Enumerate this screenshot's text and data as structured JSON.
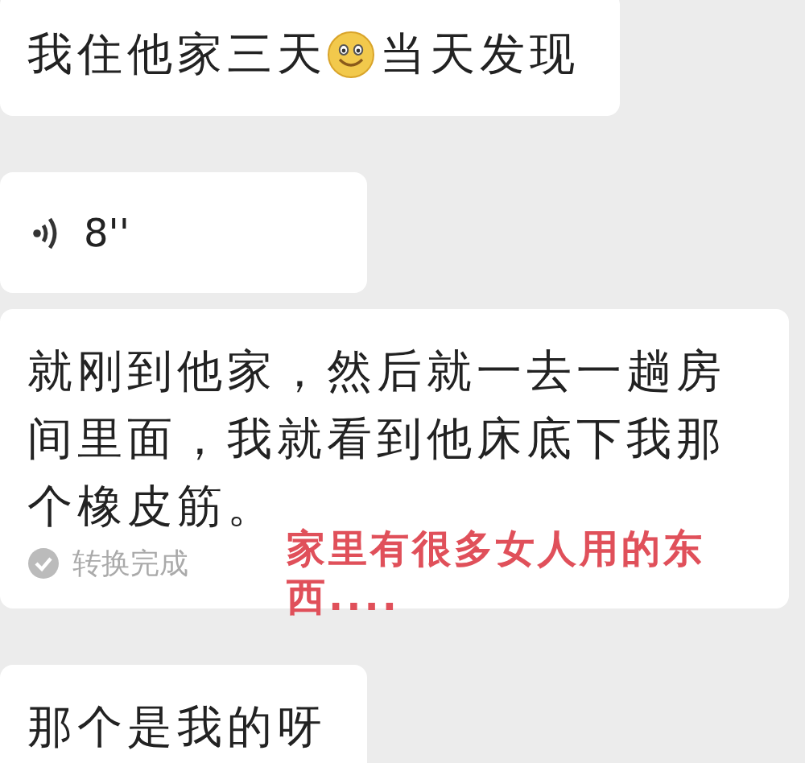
{
  "messages": [
    {
      "kind": "text",
      "segments": [
        {
          "kind": "text",
          "text": "我住他家三天"
        },
        {
          "kind": "emoji"
        },
        {
          "kind": "text",
          "text": "当天发现"
        }
      ]
    },
    {
      "kind": "voice",
      "duration": "8''"
    },
    {
      "kind": "transcript",
      "text": "就刚到他家，然后就一去一趟房间里面，我就看到他床底下我那个橡皮筋。",
      "status": "转换完成",
      "annotation": "家里有很多女人用的东西...."
    },
    {
      "kind": "text",
      "segments": [
        {
          "kind": "text",
          "text": "那个是我的呀"
        }
      ]
    }
  ]
}
